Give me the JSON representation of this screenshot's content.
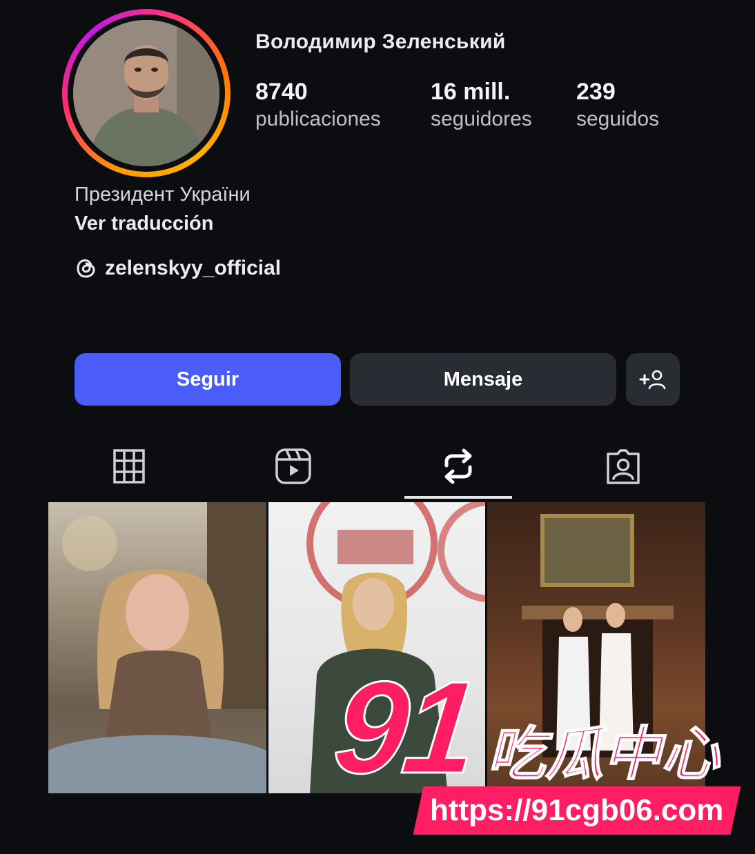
{
  "profile": {
    "username": "Володимир Зеленський",
    "stats": [
      {
        "value": "8740",
        "label": "publicaciones"
      },
      {
        "value": "16 mill.",
        "label": "seguidores"
      },
      {
        "value": "239",
        "label": "seguidos"
      }
    ],
    "bio": "Президент України",
    "translate_link": "Ver traducción",
    "threads_handle": "zelenskyy_official"
  },
  "actions": {
    "follow_label": "Seguir",
    "message_label": "Mensaje",
    "add_user_icon": "add-person-icon"
  },
  "tabs": [
    {
      "icon": "grid-icon",
      "active": false
    },
    {
      "icon": "reels-icon",
      "active": false
    },
    {
      "icon": "reposts-icon",
      "active": true
    },
    {
      "icon": "tagged-icon",
      "active": false
    }
  ],
  "watermark": {
    "number": "91",
    "chinese": "吃瓜中心",
    "url": "https://91cgb06.com"
  },
  "colors": {
    "background": "#0c0d11",
    "follow_button": "#4a5df9",
    "secondary_button": "#2a2c33",
    "watermark": "#ff1d63"
  }
}
